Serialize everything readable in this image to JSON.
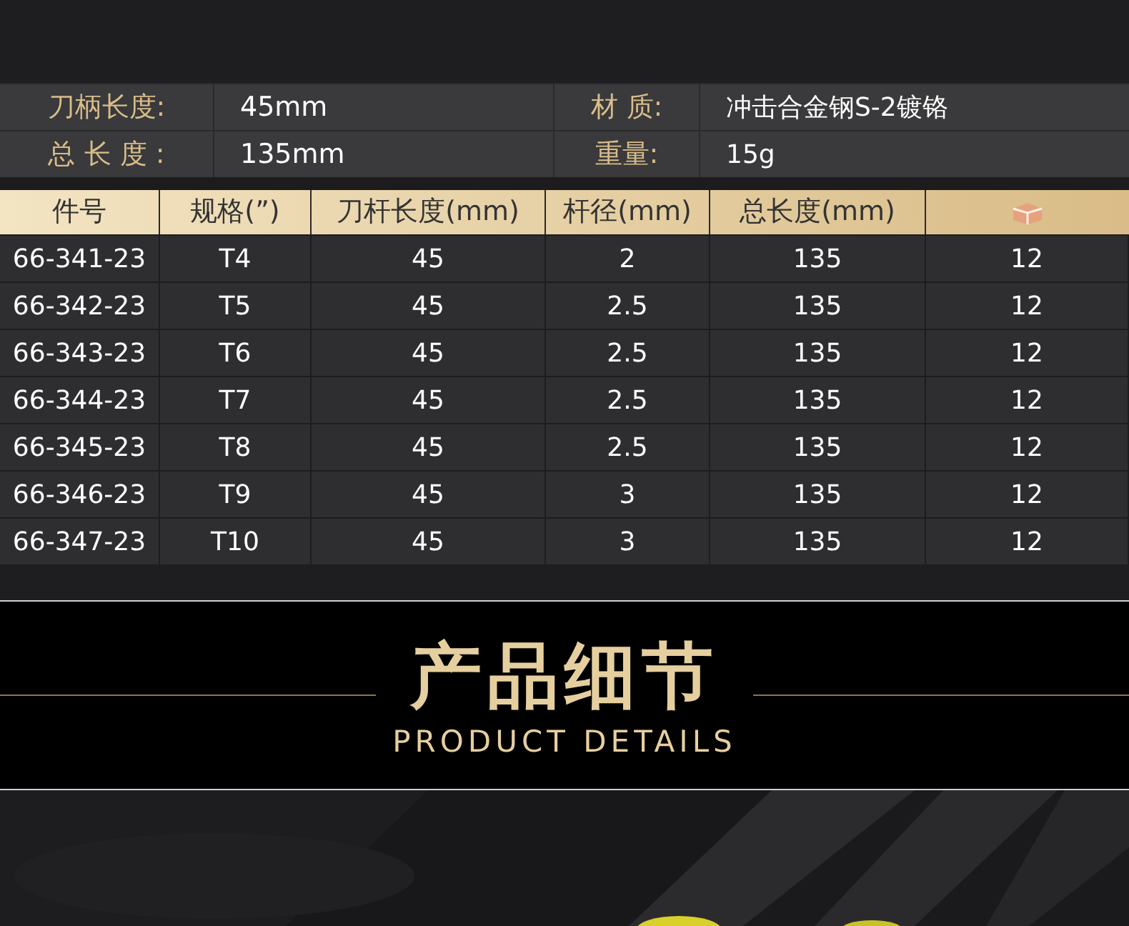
{
  "specs": [
    {
      "label": "刀柄长度:",
      "value": "45mm",
      "label_2": "材 质:",
      "value_2": "冲击合金钢S-2镀铬"
    },
    {
      "label": "总 长 度 :",
      "value": "135mm",
      "label_2": "重量:",
      "value_2": "15g"
    }
  ],
  "table": {
    "columns": [
      "件号",
      "规格(”)",
      "刀杆长度(mm)",
      "杆径(mm)",
      "总长度(mm)"
    ],
    "rows": [
      [
        "66-341-23",
        "T4",
        "45",
        "2",
        "135",
        "12"
      ],
      [
        "66-342-23",
        "T5",
        "45",
        "2.5",
        "135",
        "12"
      ],
      [
        "66-343-23",
        "T6",
        "45",
        "2.5",
        "135",
        "12"
      ],
      [
        "66-344-23",
        "T7",
        "45",
        "2.5",
        "135",
        "12"
      ],
      [
        "66-345-23",
        "T8",
        "45",
        "2.5",
        "135",
        "12"
      ],
      [
        "66-346-23",
        "T9",
        "45",
        "3",
        "135",
        "12"
      ],
      [
        "66-347-23",
        "T10",
        "45",
        "3",
        "135",
        "12"
      ]
    ]
  },
  "section": {
    "title": "产品细节",
    "subtitle": "PRODUCT DETAILS"
  }
}
